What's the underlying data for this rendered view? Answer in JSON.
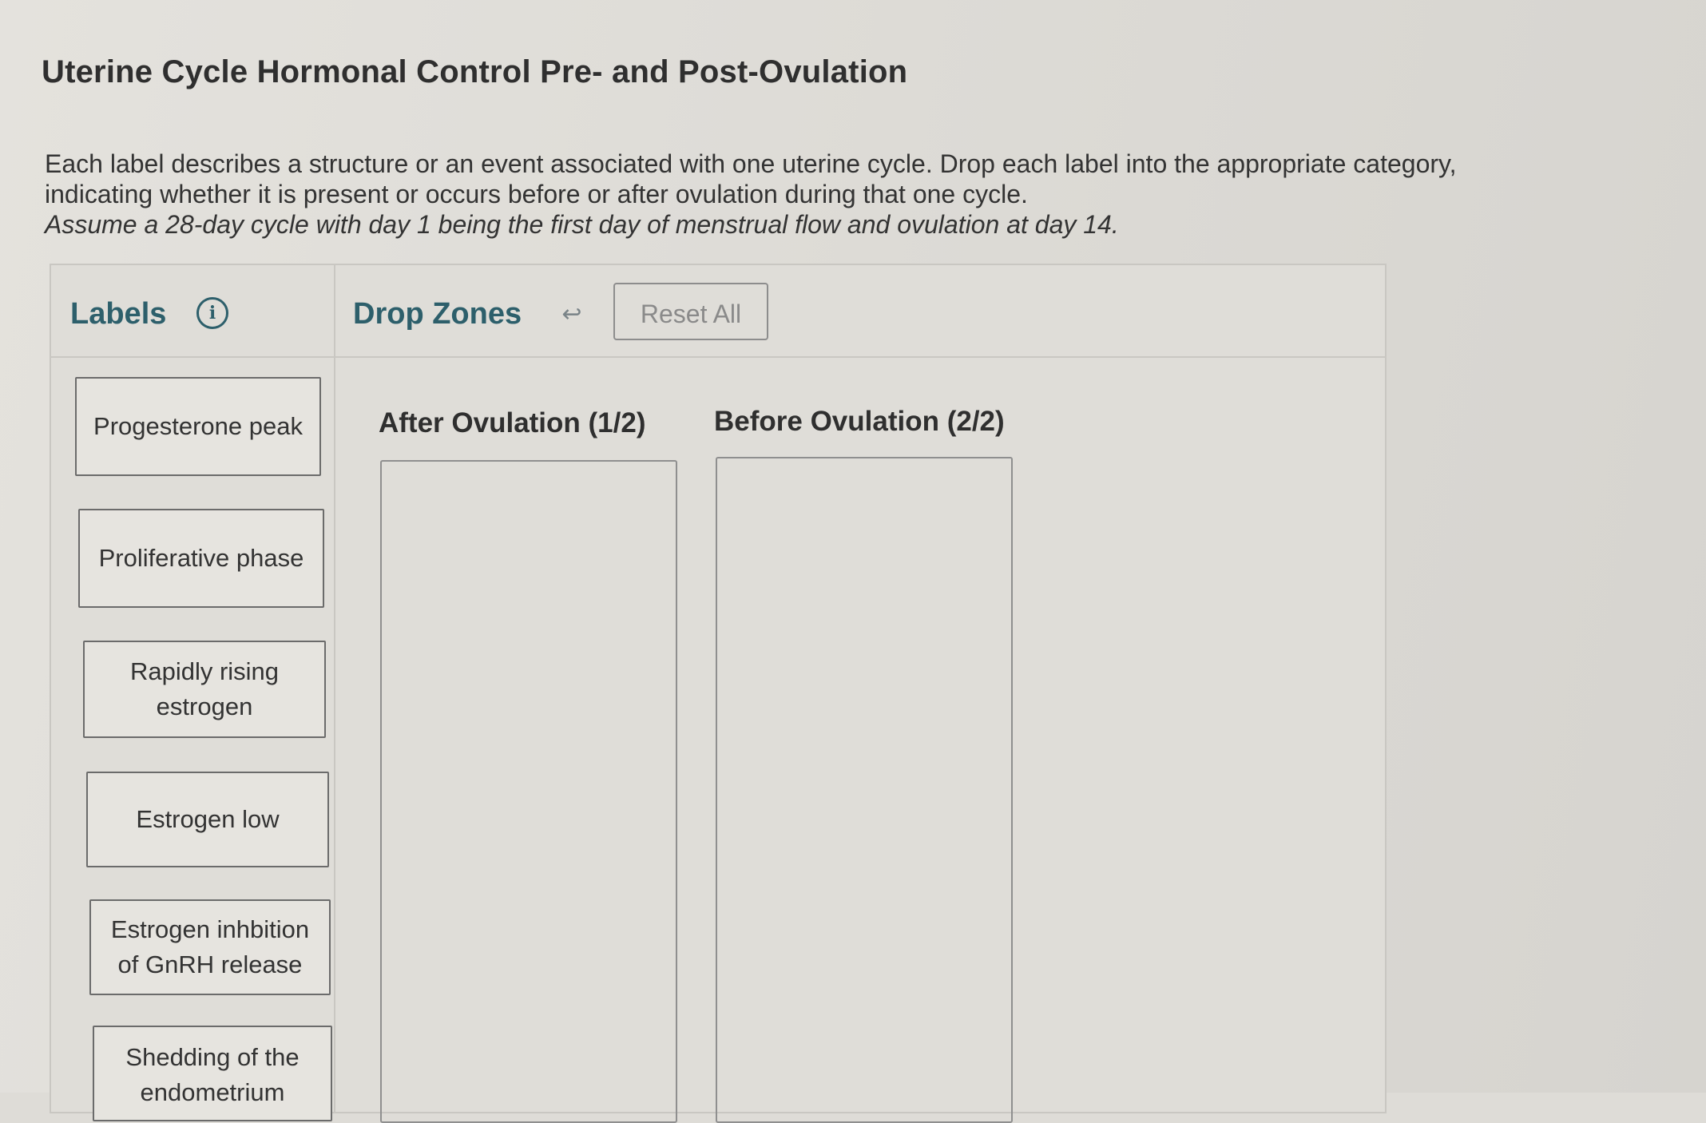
{
  "page": {
    "title": "Uterine Cycle Hormonal Control Pre- and Post-Ovulation",
    "instructions_line1": "Each label describes a structure or an event associated with one uterine cycle. Drop each label into the appropriate category,",
    "instructions_line2": "indicating whether it is present or occurs before or after ovulation during that one cycle.",
    "instructions_line3": "Assume a 28-day cycle with day 1 being the first day of menstrual flow and ovulation at day 14."
  },
  "panel": {
    "labels_heading": "Labels",
    "info_icon": "i",
    "dropzones_heading": "Drop Zones",
    "undo_icon": "↩",
    "reset_label": "Reset All"
  },
  "labels": [
    "Progesterone peak",
    "Proliferative phase",
    "Rapidly rising estrogen",
    "Estrogen low",
    "Estrogen inhbition of GnRH release",
    "Shedding of the endometrium"
  ],
  "zones": [
    {
      "title": "After Ovulation (1/2)"
    },
    {
      "title": "Before Ovulation (2/2)"
    }
  ],
  "colors": {
    "accent": "#2d5f6b",
    "border": "#6b6b6b"
  }
}
